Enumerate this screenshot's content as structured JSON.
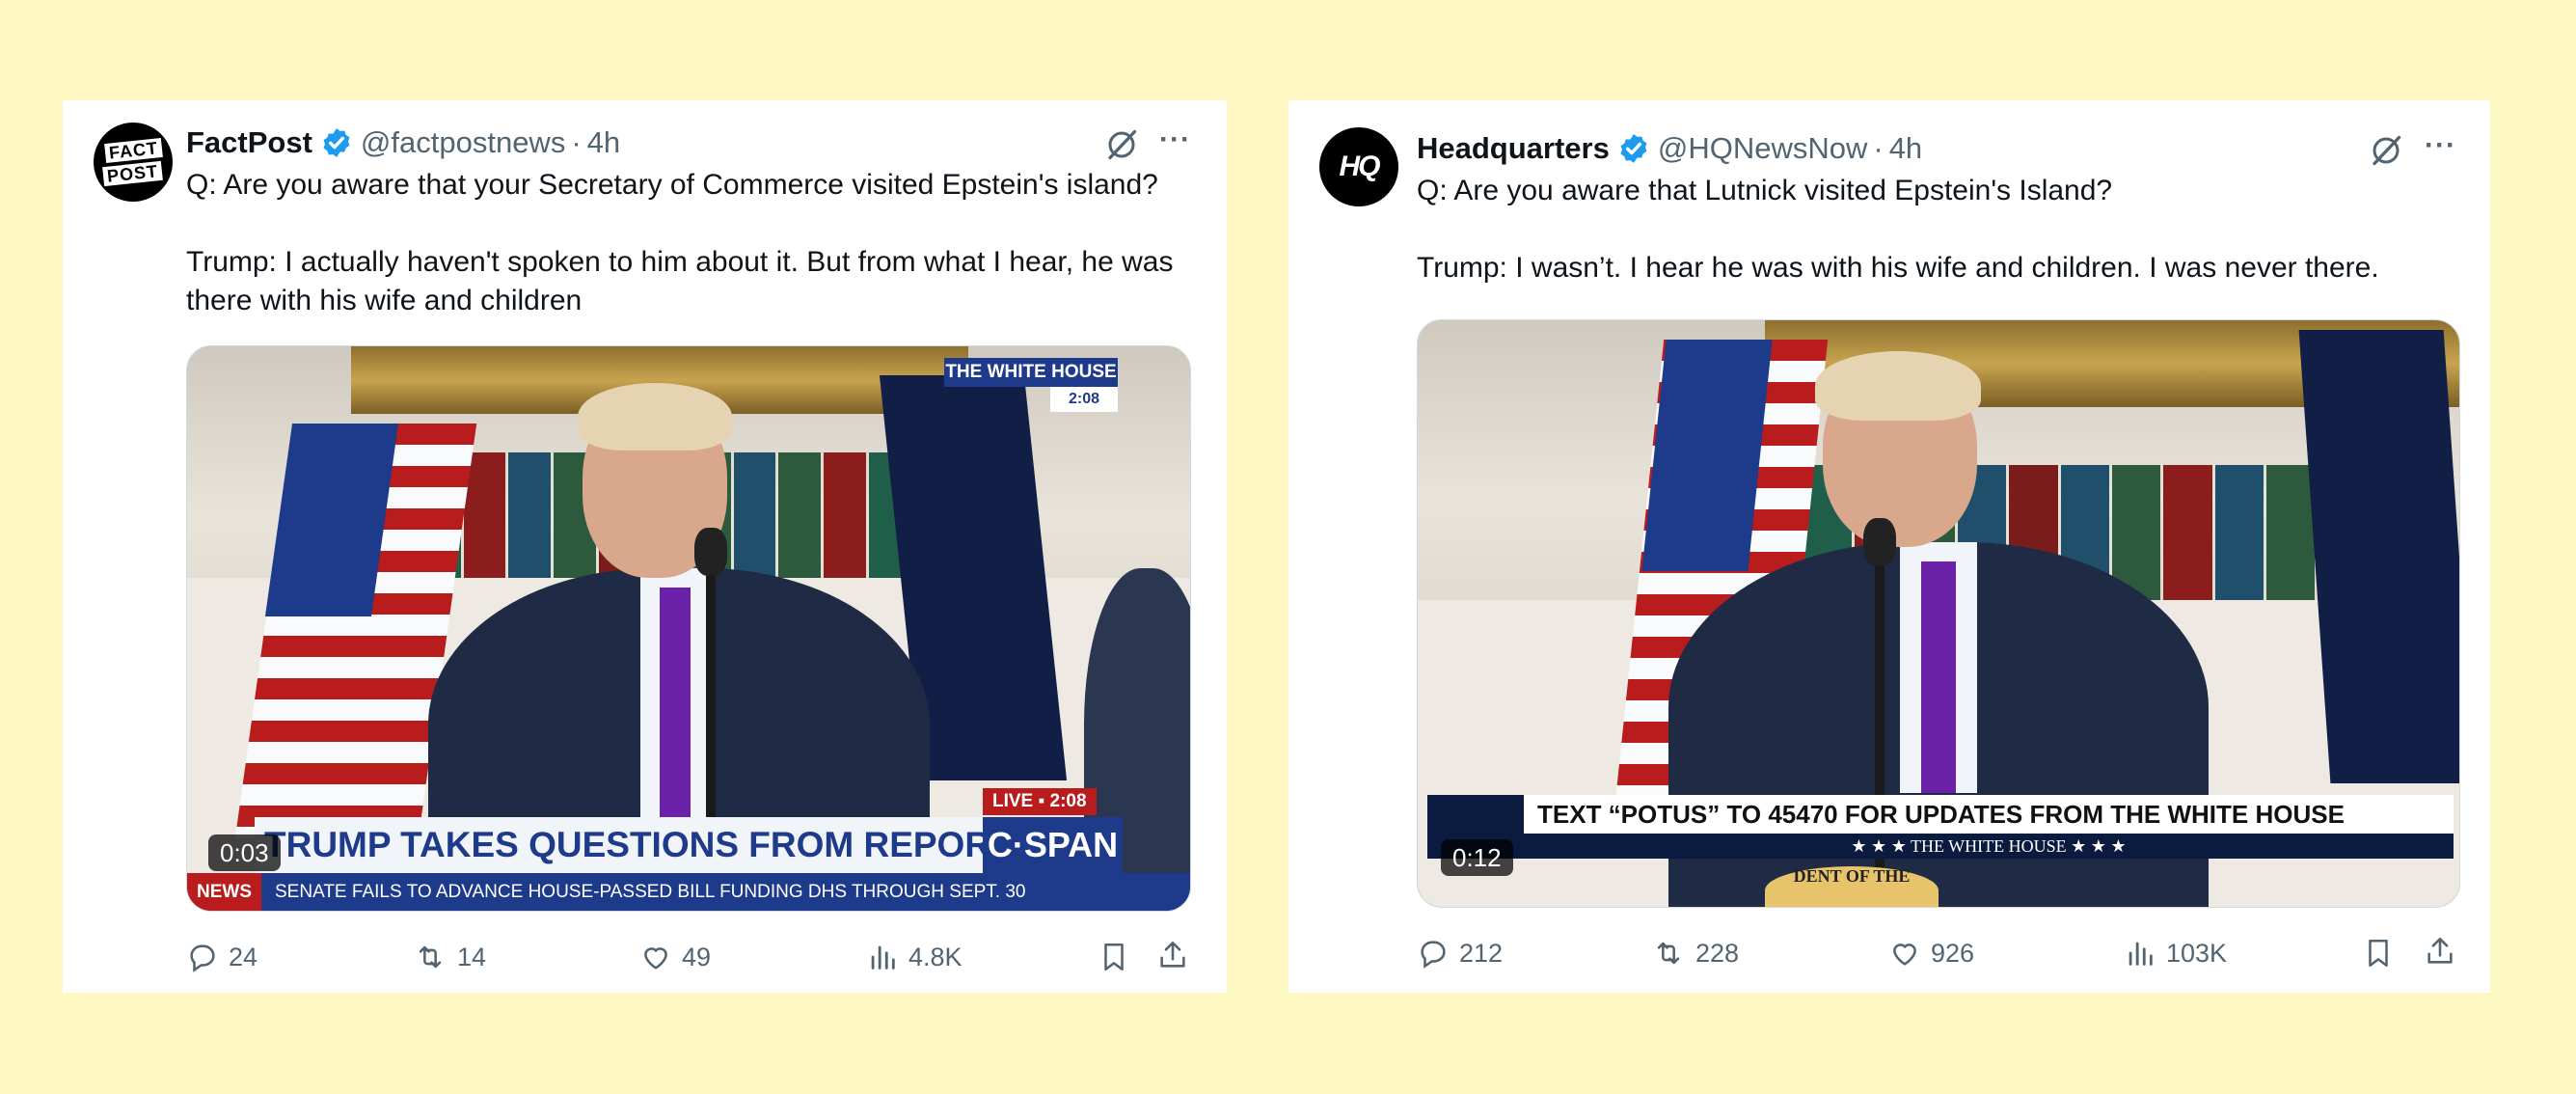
{
  "tweets": [
    {
      "author": {
        "name": "FactPost",
        "handle": "@factpostnews",
        "time": "4h",
        "avatar_text_1": "FACT",
        "avatar_text_2": "POST",
        "verified": true
      },
      "text_question": "Q: Are you aware that your Secretary of Commerce visited Epstein's island?",
      "text_answer": "Trump: I actually haven't spoken to him about it. But from what I hear, he was there with his wife and children",
      "video": {
        "duration": "0:03",
        "bug_label": "THE WHITE HOUSE",
        "bug_time": "2:08",
        "live_label": "LIVE ▪ 2:08",
        "banner": "TRUMP TAKES QUESTIONS FROM REPORTERS",
        "network": "C·SPAN",
        "ticker_tag": "NEWS",
        "ticker": "SENATE FAILS TO ADVANCE HOUSE-PASSED BILL FUNDING DHS THROUGH SEPT. 30"
      },
      "stats": {
        "replies": "24",
        "reposts": "14",
        "likes": "49",
        "views": "4.8K"
      },
      "icons": [
        "grok-icon",
        "more-icon",
        "reply-icon",
        "repost-icon",
        "like-icon",
        "views-icon",
        "bookmark-icon",
        "share-icon"
      ]
    },
    {
      "author": {
        "name": "Headquarters",
        "handle": "@HQNewsNow",
        "time": "4h",
        "avatar_text_1": "HQ",
        "verified": true
      },
      "text_question": "Q: Are you aware that Lutnick visited Epstein's Island?",
      "text_answer": "Trump: I wasn’t. I hear he was with his wife and children. I was never there.",
      "video": {
        "duration": "0:12",
        "banner": "TEXT “POTUS” TO 45470 FOR UPDATES FROM THE WHITE HOUSE",
        "sub_banner": "★ ★ ★   THE WHITE HOUSE   ★ ★ ★",
        "seal_text": "DENT OF THE"
      },
      "stats": {
        "replies": "212",
        "reposts": "228",
        "likes": "926",
        "views": "103K"
      },
      "icons": [
        "grok-icon",
        "more-icon",
        "reply-icon",
        "repost-icon",
        "like-icon",
        "views-icon",
        "bookmark-icon",
        "share-icon"
      ]
    }
  ],
  "colors": {
    "background": "#fef9c3",
    "card": "#ffffff",
    "text": "#0f1419",
    "secondary": "#536471",
    "verified": "#1d9bf0"
  }
}
